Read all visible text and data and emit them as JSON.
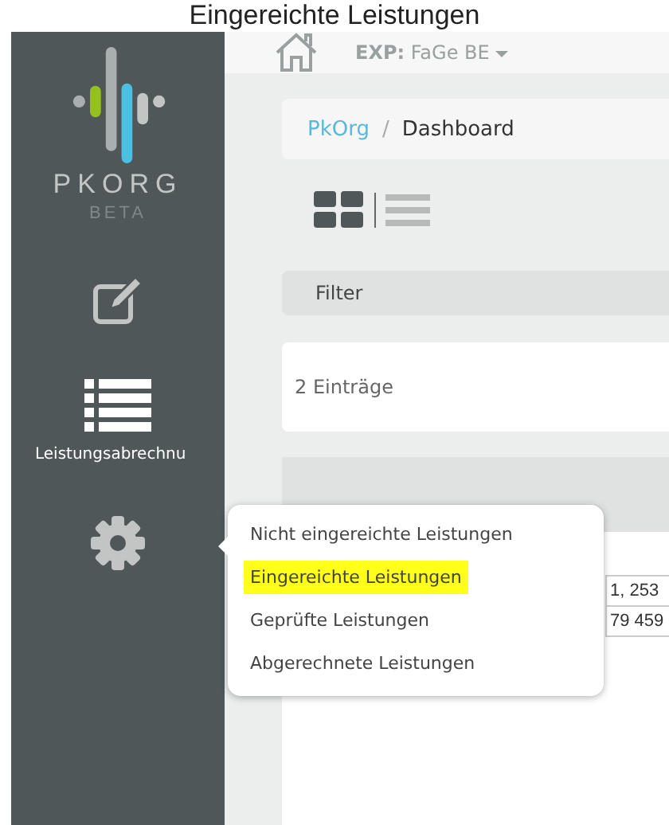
{
  "page_title": "Eingereichte Leistungen",
  "sidebar": {
    "logo_text": "PKORG",
    "logo_badge": "BETA",
    "items": [
      {
        "kind": "edit"
      },
      {
        "kind": "list",
        "label": "Leistungsabrechnu"
      },
      {
        "kind": "settings"
      }
    ]
  },
  "header": {
    "context_label": "EXP:",
    "context_value": "FaGe BE"
  },
  "breadcrumb_separator": "/",
  "breadcrumb": [
    {
      "label": "PkOrg",
      "link": true
    },
    {
      "label": "Dashboard",
      "link": false
    }
  ],
  "view_toggle": [
    {
      "kind": "grid",
      "selected": true
    },
    {
      "kind": "list",
      "selected": false
    }
  ],
  "filter": {
    "label": "Filter"
  },
  "entries_count": "2 Einträge",
  "table": {
    "rows": [
      [
        "1, 253"
      ],
      [
        "79 459"
      ]
    ]
  },
  "popover": {
    "items": [
      {
        "label": "Nicht eingereichte Leistungen",
        "selected": false
      },
      {
        "label": "Eingereichte Leistungen",
        "selected": true
      },
      {
        "label": "Geprüfte Leistungen",
        "selected": false
      },
      {
        "label": "Abgerechnete Leistungen",
        "selected": false
      }
    ]
  }
}
